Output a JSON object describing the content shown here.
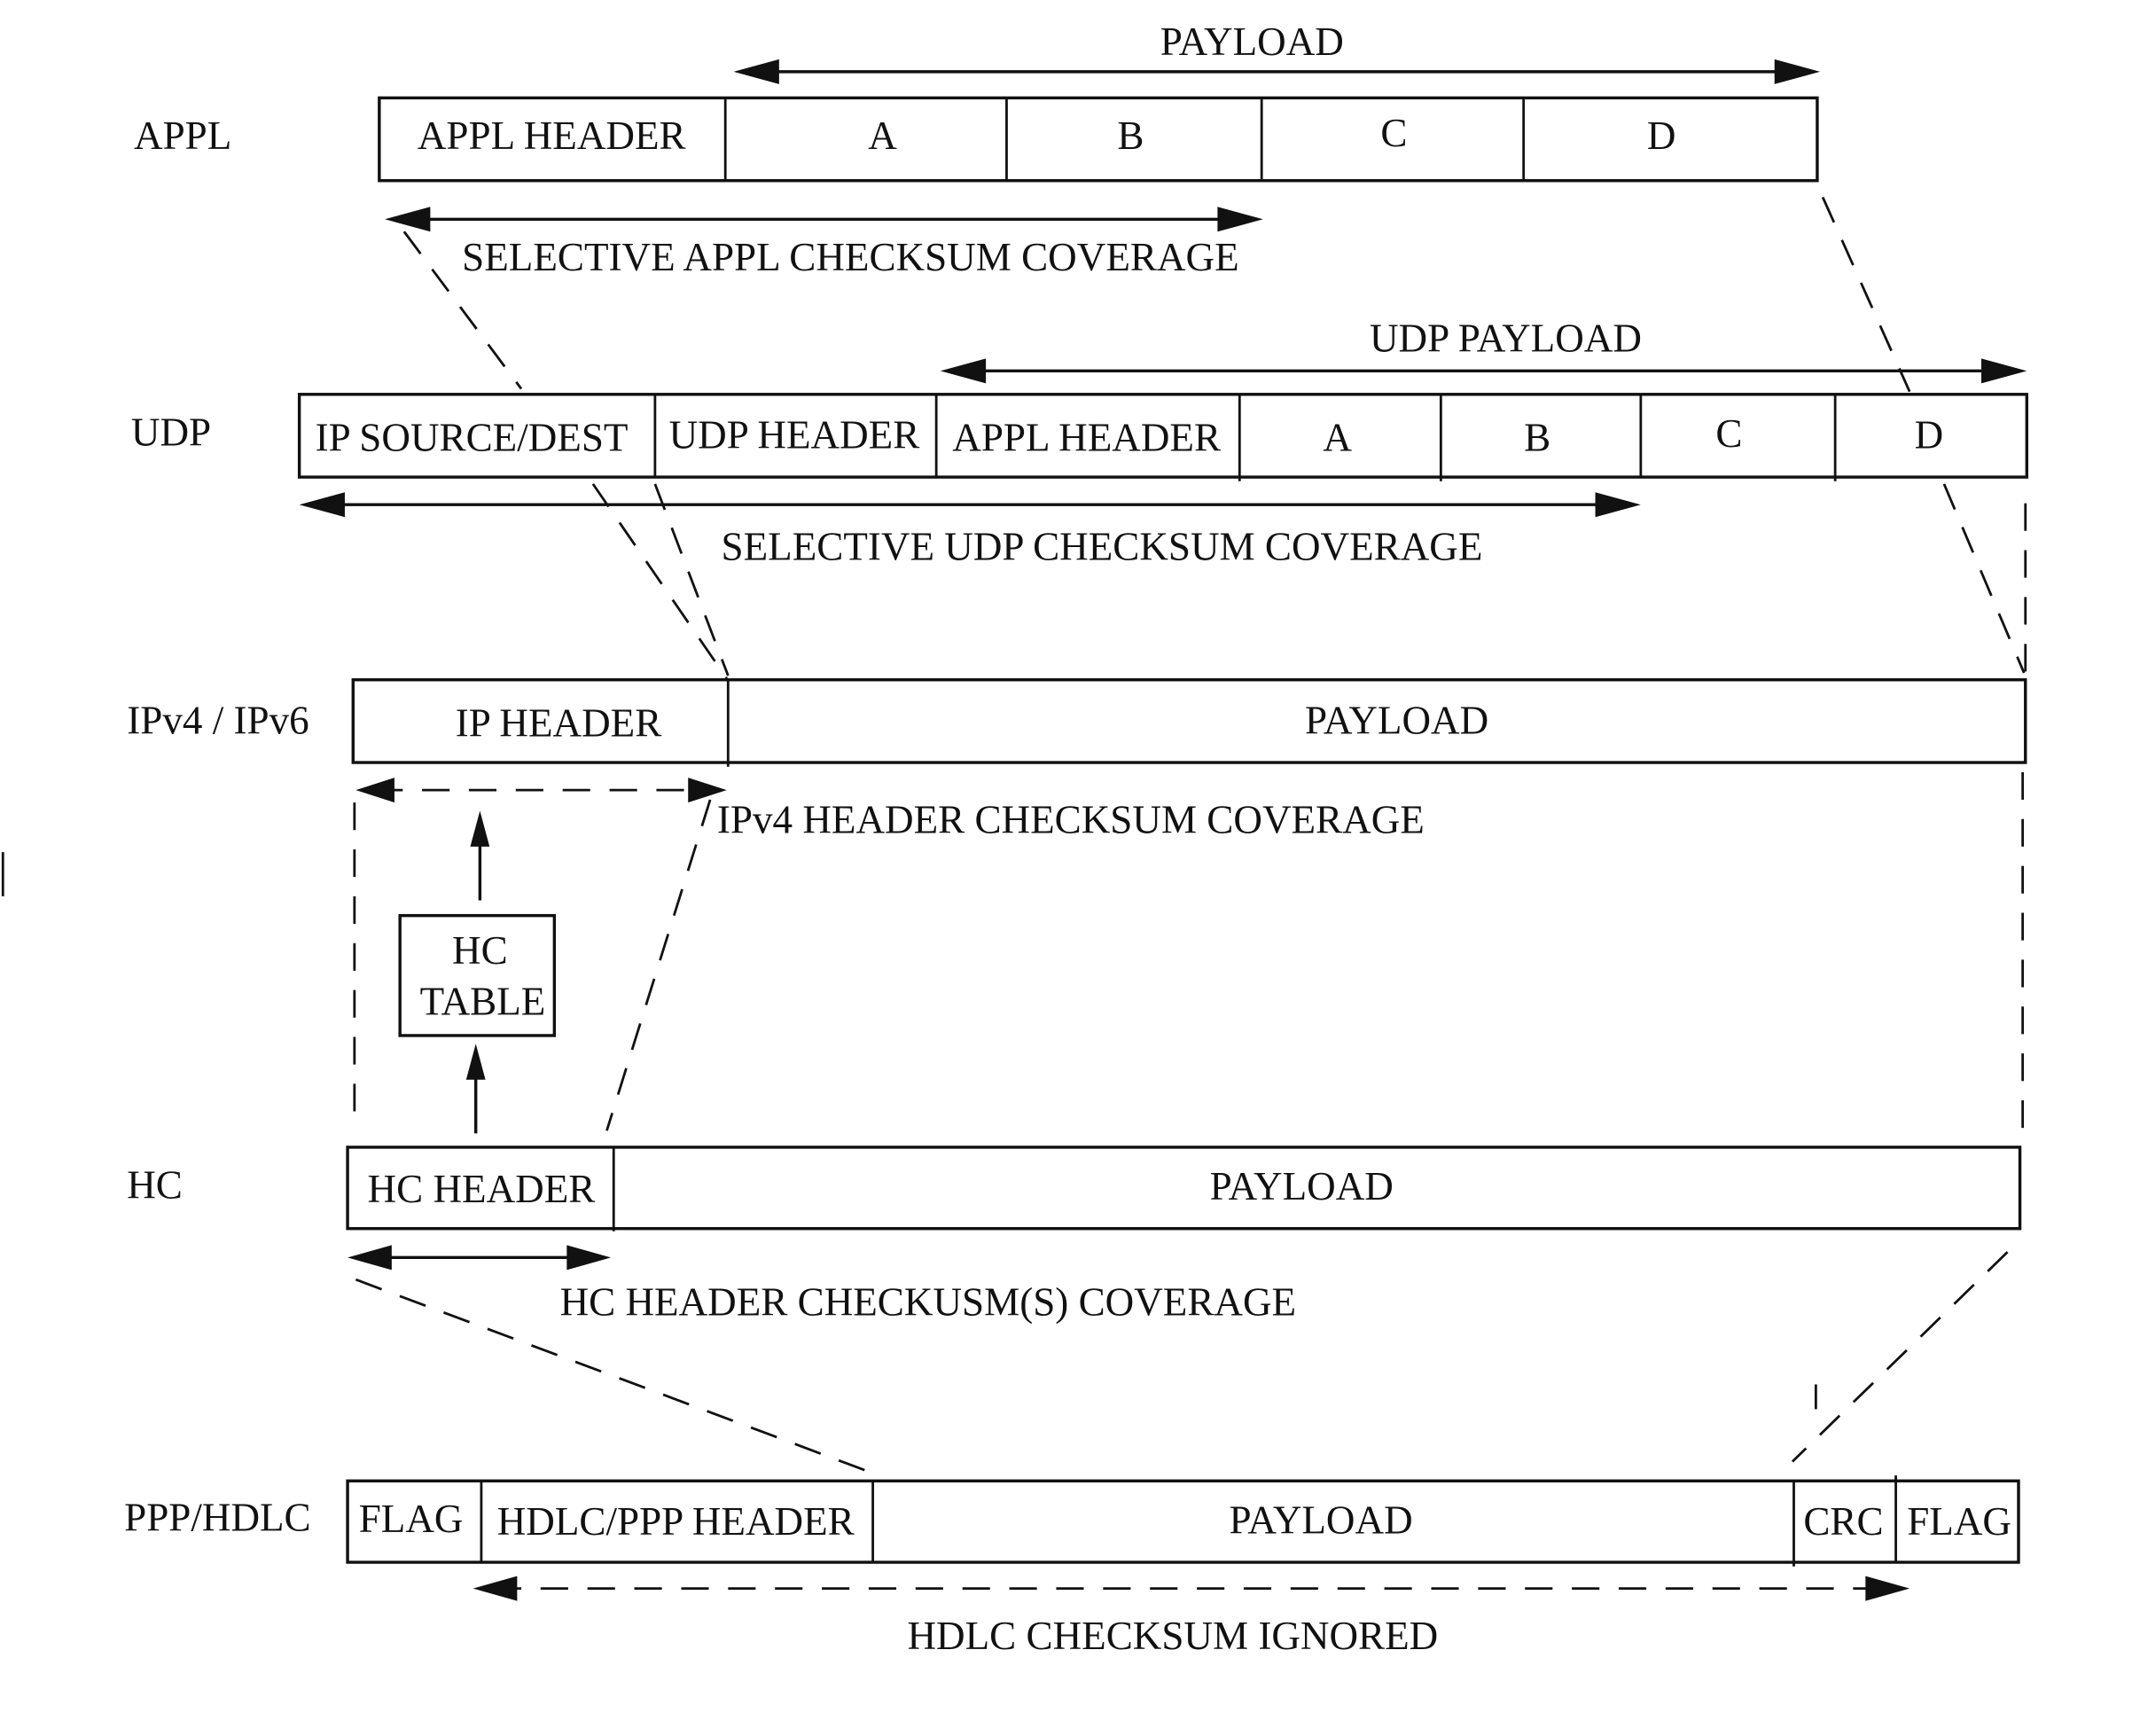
{
  "diagram": {
    "layers": {
      "appl": {
        "label": "APPL",
        "fields": [
          "APPL HEADER",
          "A",
          "B",
          "C",
          "D"
        ],
        "top_arrow": "PAYLOAD",
        "bottom_arrow": "SELECTIVE APPL CHECKSUM COVERAGE"
      },
      "udp": {
        "label": "UDP",
        "fields": [
          "IP SOURCE/DEST",
          "UDP HEADER",
          "APPL HEADER",
          "A",
          "B",
          "C",
          "D"
        ],
        "top_arrow": "UDP PAYLOAD",
        "bottom_arrow": "SELECTIVE UDP CHECKSUM COVERAGE"
      },
      "ip": {
        "label": "IPv4 / IPv6",
        "fields": [
          "IP HEADER",
          "PAYLOAD"
        ],
        "bottom_arrow": "IPv4 HEADER CHECKSUM COVERAGE"
      },
      "hc_table": {
        "line1": "HC",
        "line2": "TABLE"
      },
      "hc": {
        "label": "HC",
        "fields": [
          "HC  HEADER",
          "PAYLOAD"
        ],
        "bottom_arrow": "HC HEADER CHECKUSM(S) COVERAGE"
      },
      "ppp": {
        "label": "PPP/HDLC",
        "fields": [
          "FLAG",
          "HDLC/PPP HEADER",
          "PAYLOAD",
          "CRC",
          "FLAG"
        ],
        "bottom_arrow": "HDLC CHECKSUM IGNORED"
      }
    }
  }
}
